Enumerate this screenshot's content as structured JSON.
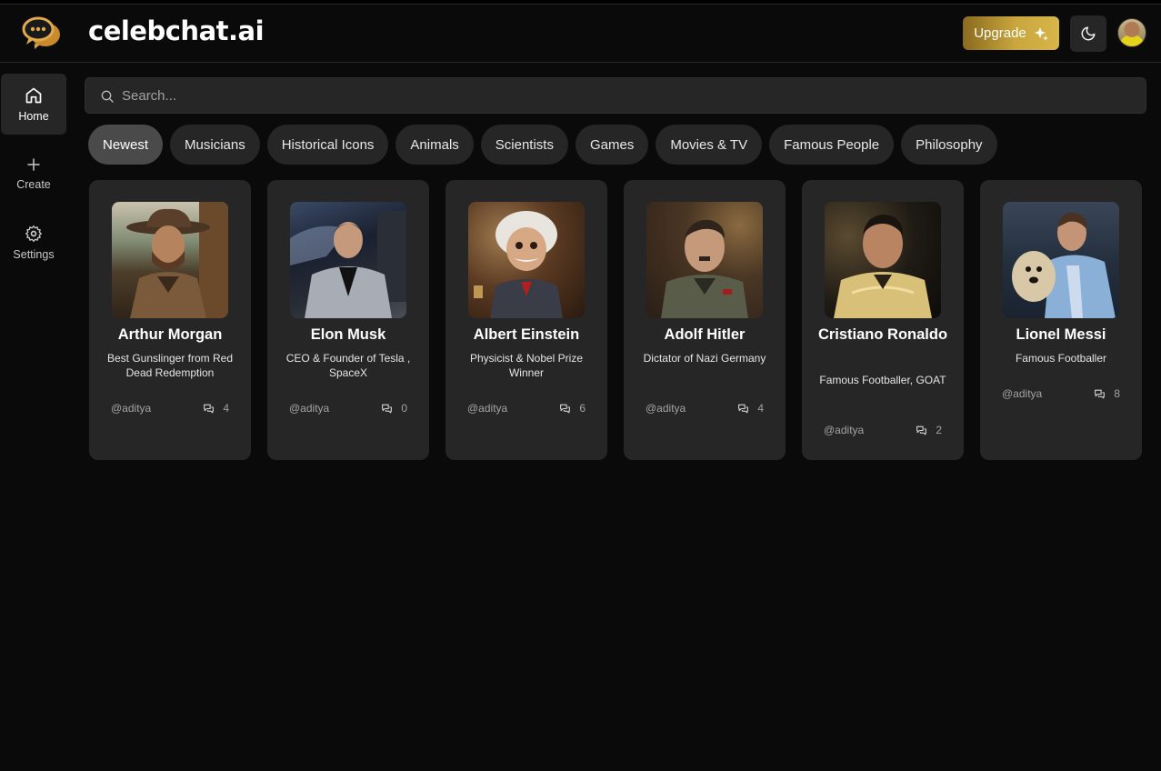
{
  "header": {
    "brand": "celebchat.ai",
    "upgrade_label": "Upgrade"
  },
  "sidebar": {
    "items": [
      {
        "label": "Home",
        "icon": "home-icon",
        "active": true
      },
      {
        "label": "Create",
        "icon": "plus-icon",
        "active": false
      },
      {
        "label": "Settings",
        "icon": "gear-icon",
        "active": false
      }
    ]
  },
  "search": {
    "placeholder": "Search..."
  },
  "categories": [
    "Newest",
    "Musicians",
    "Historical Icons",
    "Animals",
    "Scientists",
    "Games",
    "Movies & TV",
    "Famous People",
    "Philosophy"
  ],
  "active_category": "Newest",
  "cards": [
    {
      "name": "Arthur Morgan",
      "description": "Best Gunslinger from Red Dead Redemption",
      "author": "@aditya",
      "messages": "4"
    },
    {
      "name": "Elon Musk",
      "description": "CEO & Founder of Tesla , SpaceX",
      "author": "@aditya",
      "messages": "0"
    },
    {
      "name": "Albert Einstein",
      "description": "Physicist & Nobel Prize Winner",
      "author": "@aditya",
      "messages": "6"
    },
    {
      "name": "Adolf Hitler",
      "description": "Dictator of Nazi Germany",
      "author": "@aditya",
      "messages": "4"
    },
    {
      "name": "Cristiano Ronaldo",
      "description": "Famous Footballer, GOAT",
      "author": "@aditya",
      "messages": "2"
    },
    {
      "name": "Lionel Messi",
      "description": "Famous Footballer",
      "author": "@aditya",
      "messages": "8"
    }
  ],
  "colors": {
    "background": "#0a0a0a",
    "surface": "#262626",
    "accent_gold": "#c9a63e"
  }
}
